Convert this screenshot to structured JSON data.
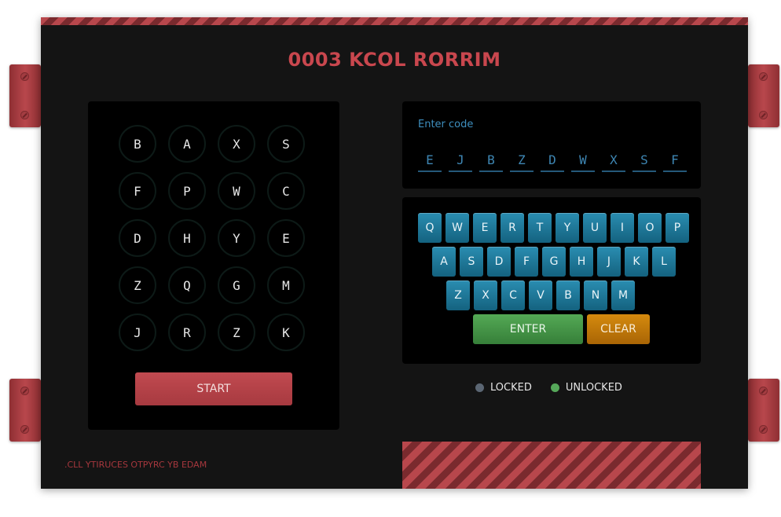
{
  "title": "0003 KCOL RORRIM",
  "letter_grid": [
    [
      "B",
      "A",
      "X",
      "S"
    ],
    [
      "F",
      "P",
      "W",
      "C"
    ],
    [
      "D",
      "H",
      "Y",
      "E"
    ],
    [
      "Z",
      "Q",
      "G",
      "M"
    ],
    [
      "J",
      "R",
      "Z",
      "K"
    ]
  ],
  "start_label": "START",
  "code": {
    "label": "Enter code",
    "slots": [
      "E",
      "J",
      "B",
      "Z",
      "D",
      "W",
      "X",
      "S",
      "F"
    ]
  },
  "keyboard": {
    "rows": [
      [
        "Q",
        "W",
        "E",
        "R",
        "T",
        "Y",
        "U",
        "I",
        "O",
        "P"
      ],
      [
        "A",
        "S",
        "D",
        "F",
        "G",
        "H",
        "J",
        "K",
        "L"
      ],
      [
        "Z",
        "X",
        "C",
        "V",
        "B",
        "N",
        "M"
      ]
    ],
    "enter_label": "ENTER",
    "clear_label": "CLEAR"
  },
  "legend": {
    "locked_label": "LOCKED",
    "unlocked_label": "UNLOCKED",
    "locked_color": "#5b6673",
    "unlocked_color": "#56a85a"
  },
  "credit": ".CLL YTIRUCES OTPYRC YB EDAM",
  "colors": {
    "accent": "#c9474e",
    "key_blue": "#1f7fa2",
    "enter_green": "#47964a",
    "clear_orange": "#c07a0a"
  }
}
